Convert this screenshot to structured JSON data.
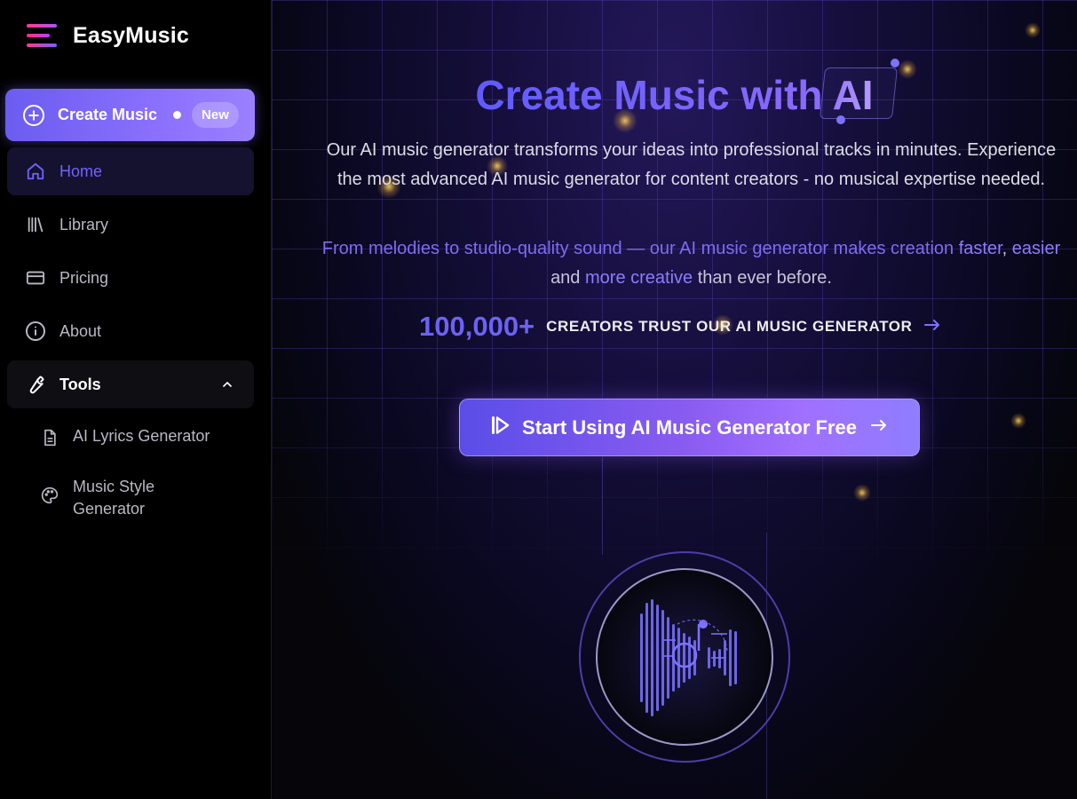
{
  "brand": {
    "name": "EasyMusic"
  },
  "sidebar": {
    "create": {
      "label": "Create Music",
      "badge": "New"
    },
    "items": [
      {
        "label": "Home",
        "icon": "home-icon",
        "active": true
      },
      {
        "label": "Library",
        "icon": "library-icon"
      },
      {
        "label": "Pricing",
        "icon": "card-icon"
      },
      {
        "label": "About",
        "icon": "info-icon"
      },
      {
        "label": "Tools",
        "icon": "wrench-icon",
        "expanded": true
      }
    ],
    "tools": [
      {
        "label": "AI Lyrics Generator",
        "icon": "document-icon"
      },
      {
        "label": "Music Style Generator",
        "icon": "palette-icon"
      }
    ]
  },
  "hero": {
    "title_part1": "Create Music with ",
    "title_part2": "AI",
    "description": "Our AI music generator transforms your ideas into professional tracks in minutes. Experience the most advanced AI music generator for content creators - no musical expertise needed.",
    "tagline_a": "From melodies to studio-quality sound — our AI music generator makes creation ",
    "tagline_faster": "faster",
    "tagline_comma": ", ",
    "tagline_easier": "easier",
    "tagline_and": " and ",
    "tagline_more": "more creative",
    "tagline_end": " than ever before.",
    "stats_number": "100,000+",
    "stats_text": "CREATORS TRUST OUR AI MUSIC GENERATOR",
    "cta_label": "Start Using AI Music Generator Free"
  },
  "colors": {
    "accent": "#6f63ff",
    "sidebar_bg": "#000000",
    "active_bg": "#15122f"
  }
}
